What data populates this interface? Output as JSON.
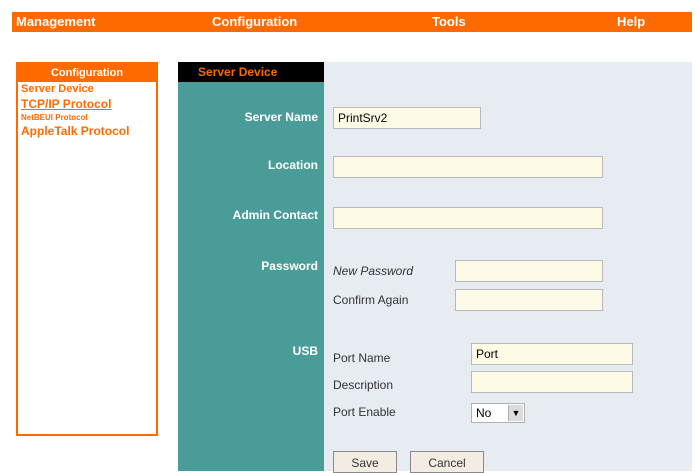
{
  "nav": {
    "management": "Management",
    "configuration": "Configuration",
    "tools": "Tools",
    "help": "Help"
  },
  "sidebar": {
    "title": "Configuration",
    "items": [
      {
        "label": "Server Device"
      },
      {
        "label": "TCP/IP Protocol"
      },
      {
        "label": "NetBEUI Protocol"
      },
      {
        "label": "AppleTalk Protocol"
      }
    ]
  },
  "panel": {
    "title": "Server Device"
  },
  "form": {
    "server_name": {
      "label": "Server Name",
      "value": "PrintSrv2"
    },
    "location": {
      "label": "Location",
      "value": ""
    },
    "admin_contact": {
      "label": "Admin Contact",
      "value": ""
    },
    "password": {
      "label": "Password",
      "new_label": "New Password",
      "confirm_label": "Confirm Again",
      "new_value": "",
      "confirm_value": ""
    },
    "usb": {
      "label": "USB",
      "port_name_label": "Port Name",
      "port_name_value": "Port",
      "description_label": "Description",
      "description_value": "",
      "enable_label": "Port Enable",
      "enable_value": "No"
    }
  },
  "actions": {
    "save": "Save",
    "cancel": "Cancel"
  },
  "colors": {
    "accent": "#ff6a00",
    "teal": "#4a9c98",
    "form_bg": "#e6ecf2"
  }
}
